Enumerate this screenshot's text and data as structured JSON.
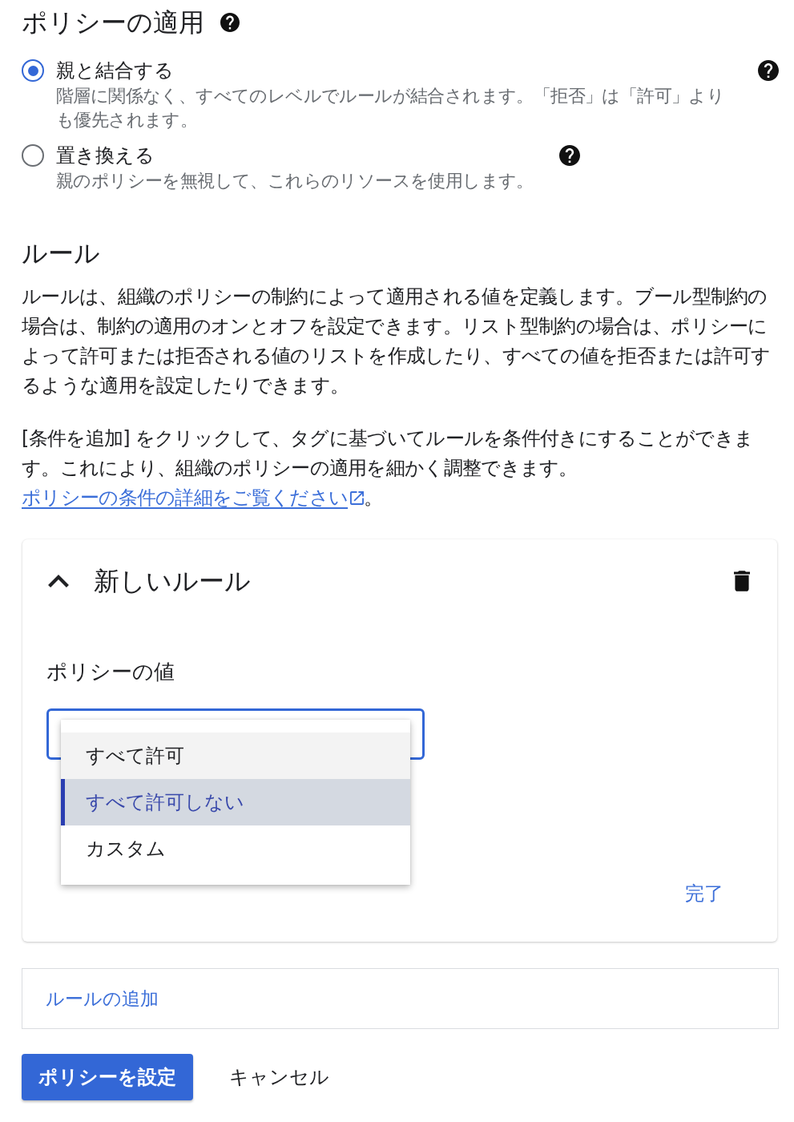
{
  "enforcement": {
    "title": "ポリシーの適用",
    "options": [
      {
        "label": "親と結合する",
        "description": "階層に関係なく、すべてのレベルでルールが結合されます。「拒否」は「許可」よりも優先されます。",
        "selected": true
      },
      {
        "label": "置き換える",
        "description": "親のポリシーを無視して、これらのリソースを使用します。",
        "selected": false
      }
    ]
  },
  "rules": {
    "title": "ルール",
    "paragraphs": [
      {
        "text": "ルールは、組織のポリシーの制約によって適用される値を定義します。ブール型制約の場合は、制約の適用のオンとオフを設定できます。リスト型制約の場合は、ポリシーによって許可または拒否される値のリストを作成したり、すべての値を拒否または許可するような適用を設定したりできます。"
      },
      {
        "text": "[条件を追加] をクリックして、タグに基づいてルールを条件付きにすることができます。これにより、組織のポリシーの適用を細かく調整できます。",
        "link": "ポリシーの条件の詳細をご覧ください",
        "tail": "。"
      }
    ]
  },
  "rule_card": {
    "title": "新しいルール",
    "expanded": true,
    "field_label": "ポリシーの値",
    "menu": [
      {
        "label": "すべて許可",
        "selected": false,
        "highlighted": true
      },
      {
        "label": "すべて許可しない",
        "selected": true,
        "highlighted": false
      },
      {
        "label": "カスタム",
        "selected": false,
        "highlighted": false
      }
    ],
    "done": "完了"
  },
  "add_rule": "ルールの追加",
  "buttons": {
    "submit": "ポリシーを設定",
    "cancel": "キャンセル"
  }
}
